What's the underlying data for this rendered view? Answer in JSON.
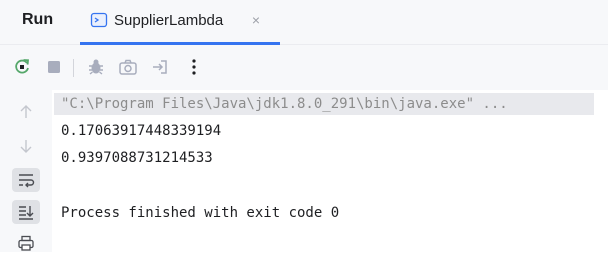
{
  "header": {
    "run_title": "Run",
    "tab_label": "SupplierLambda",
    "tab_close": "×"
  },
  "toolbar": {
    "icons": [
      "rerun-icon",
      "stop-icon",
      "debug-icon",
      "screenshot-icon",
      "exit-icon",
      "more-options-icon"
    ]
  },
  "gutter": {
    "icons": [
      "arrow-up-icon",
      "arrow-down-icon",
      "soft-wrap-icon",
      "scroll-to-end-icon",
      "print-icon"
    ]
  },
  "console": {
    "command_line": "\"C:\\Program Files\\Java\\jdk1.8.0_291\\bin\\java.exe\" ...",
    "output": [
      "0.17063917448339194",
      "0.9397088731214533"
    ],
    "exit_message": "Process finished with exit code 0"
  },
  "colors": {
    "accent": "#3574f0",
    "rerun": "#208a3c",
    "command_text": "#8c8c8c",
    "panel_bg": "#f7f8fa"
  }
}
